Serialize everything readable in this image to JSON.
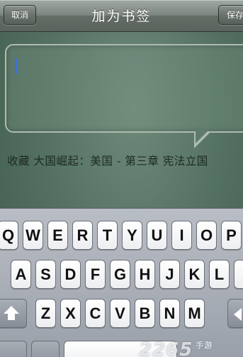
{
  "navbar": {
    "title": "加为书签",
    "cancel_label": "取消",
    "save_label": "保存"
  },
  "bookmark": {
    "input_value": "",
    "caption": "收藏 大国崛起：美国 - 第三章 宪法立国"
  },
  "keyboard": {
    "row1": [
      "Q",
      "W",
      "E",
      "R",
      "T",
      "Y",
      "U",
      "I",
      "O",
      "P"
    ],
    "row2": [
      "A",
      "S",
      "D",
      "F",
      "G",
      "H",
      "J",
      "K",
      "L"
    ],
    "row3": [
      "Z",
      "X",
      "C",
      "V",
      "B",
      "N",
      "M"
    ],
    "shift_icon": "shift-up-arrow-icon",
    "delete_icon": "backspace-icon"
  },
  "watermark": {
    "text": "2265",
    "suffix": "手游"
  },
  "colors": {
    "cursor": "#3c6fd9",
    "background": "#557262"
  }
}
